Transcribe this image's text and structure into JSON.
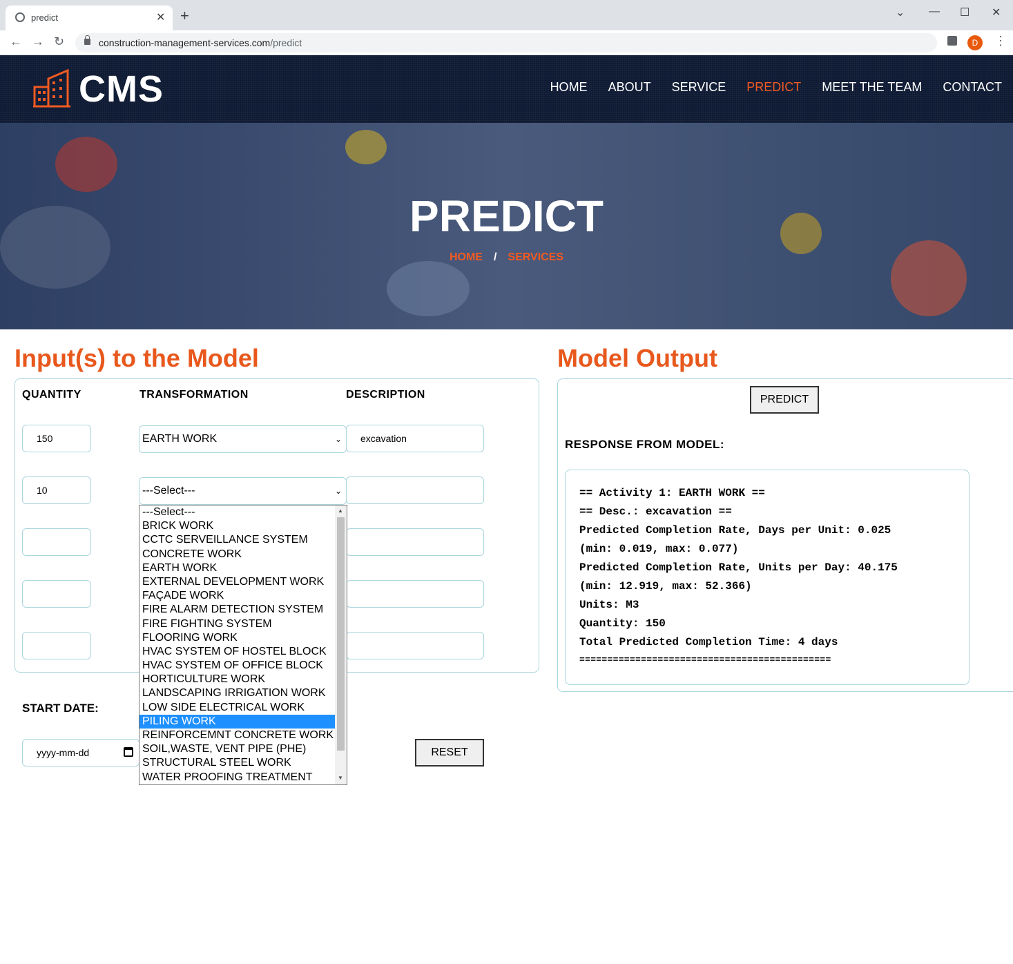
{
  "browser": {
    "tab_title": "predict",
    "url_domain": "construction-management-services.com",
    "url_path": "/predict",
    "avatar_initial": "D"
  },
  "site": {
    "logo_text": "CMS",
    "accent_color": "#f15a22",
    "nav": [
      {
        "label": "HOME"
      },
      {
        "label": "ABOUT"
      },
      {
        "label": "SERVICE"
      },
      {
        "label": "PREDICT",
        "active": true
      },
      {
        "label": "MEET THE TEAM"
      },
      {
        "label": "CONTACT"
      }
    ]
  },
  "hero": {
    "title": "PREDICT",
    "crumb_home": "HOME",
    "crumb_sep": "/",
    "crumb_current": "SERVICES"
  },
  "inputs": {
    "title": "Input(s) to the Model",
    "headers": {
      "quantity": "QUANTITY",
      "transformation": "TRANSFORMATION",
      "description": "DESCRIPTION"
    },
    "rows": [
      {
        "quantity": "150",
        "transformation": "EARTH WORK",
        "description": "excavation"
      },
      {
        "quantity": "10",
        "transformation": "---Select---",
        "description": ""
      },
      {
        "quantity": "",
        "transformation": "",
        "description": ""
      },
      {
        "quantity": "",
        "transformation": "",
        "description": ""
      },
      {
        "quantity": "",
        "transformation": "",
        "description": ""
      }
    ],
    "start_date_label": "START DATE:",
    "date_placeholder": "yyyy-mm-dd",
    "reset_label": "RESET"
  },
  "dropdown": {
    "options": [
      "---Select---",
      "BRICK WORK",
      "CCTC SERVEILLANCE SYSTEM",
      "CONCRETE WORK",
      "EARTH WORK",
      "EXTERNAL DEVELOPMENT WORK",
      "FAÇADE WORK",
      "FIRE ALARM DETECTION SYSTEM",
      "FIRE FIGHTING SYSTEM",
      "FLOORING WORK",
      "HVAC SYSTEM OF HOSTEL BLOCK",
      "HVAC SYSTEM OF OFFICE BLOCK",
      "HORTICULTURE WORK",
      "LANDSCAPING IRRIGATION WORK",
      "LOW SIDE ELECTRICAL WORK",
      "PILING WORK",
      "REINFORCEMNT CONCRETE WORK",
      "SOIL,WASTE, VENT PIPE (PHE)",
      "STRUCTURAL STEEL WORK",
      "WATER PROOFING TREATMENT"
    ],
    "highlighted": "PILING WORK"
  },
  "output": {
    "title": "Model Output",
    "predict_label": "PREDICT",
    "response_label": "RESPONSE FROM MODEL:",
    "lines": [
      "== Activity 1: EARTH WORK ==",
      "== Desc.: excavation ==",
      "Predicted Completion Rate, Days per Unit: 0.025",
      "(min: 0.019, max: 0.077)",
      "Predicted Completion Rate, Units per Day: 40.175",
      "(min: 12.919, max: 52.366)",
      "Units: M3",
      "Quantity: 150",
      "Total Predicted Completion Time: 4 days",
      "============================================="
    ]
  }
}
